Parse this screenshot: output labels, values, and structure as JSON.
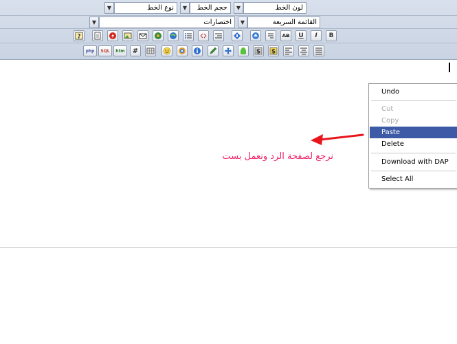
{
  "toolbar": {
    "row1": {
      "font_color": "لون الخط",
      "font_size": "حجم الخط",
      "font_type": "نوع الخط"
    },
    "row2": {
      "quick_list": "القائمة السريعة",
      "shortcuts": "اختصارات"
    },
    "row3_buttons": [
      "B",
      "I",
      "U",
      "AB"
    ],
    "row4_buttons": [
      "php",
      "SQL",
      "htm",
      "#"
    ]
  },
  "context_menu": {
    "undo": "Undo",
    "cut": "Cut",
    "copy": "Copy",
    "paste": "Paste",
    "delete": "Delete",
    "download": "Download with DAP",
    "select_all": "Select All"
  },
  "annotation": {
    "text": "نرجع لصفحة الرد ونعمل بست"
  },
  "colors": {
    "selection": "#3d5aa6",
    "annotation": "#f0226a",
    "arrow": "#e8151c"
  }
}
